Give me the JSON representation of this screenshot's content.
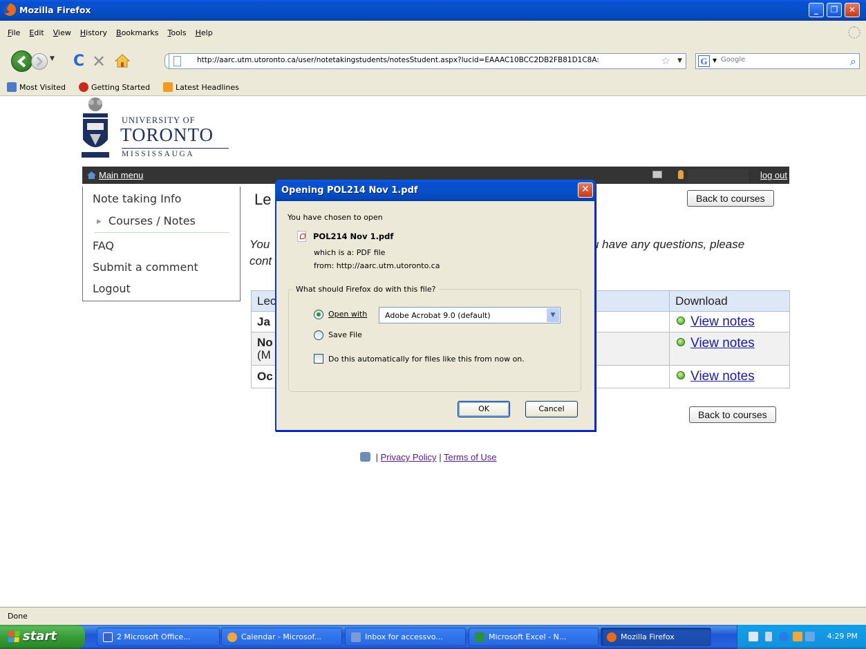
{
  "window": {
    "title": "Mozilla Firefox"
  },
  "menu": [
    "File",
    "Edit",
    "View",
    "History",
    "Bookmarks",
    "Tools",
    "Help"
  ],
  "nav": {
    "url": "http://aarc.utm.utoronto.ca/user/notetakingstudents/notesStudent.aspx?lucid=EAAAC10BCC2DB2FB81D1C8A:",
    "search_placeholder": "Google"
  },
  "bookmarks": [
    "Most Visited",
    "Getting Started",
    "Latest Headlines"
  ],
  "logo": {
    "line1": "UNIVERSITY OF",
    "line2": "TORONTO",
    "line3": "MISSISSAUGA"
  },
  "site_nav": {
    "main_menu": "Main menu",
    "logout": "log out"
  },
  "side_menu": {
    "items": [
      "Note taking Info",
      "Courses / Notes",
      "FAQ",
      "Submit a comment",
      "Logout"
    ]
  },
  "page": {
    "heading": "Le",
    "back_button": "Back to courses",
    "intro_line1_left": "You",
    "intro_line1_right": "u have any questions, please",
    "intro_line2": "cont"
  },
  "table": {
    "headers": [
      "Lec",
      "Download"
    ],
    "rows": [
      {
        "lecture": "Ja",
        "download": "View notes"
      },
      {
        "lecture": "No",
        "lecture2": "(M",
        "download": "View notes"
      },
      {
        "lecture": "Oc",
        "download": "View notes"
      }
    ]
  },
  "footer": {
    "separator": "|",
    "privacy": "Privacy Policy",
    "terms": "Terms of Use"
  },
  "dialog": {
    "title": "Opening POL214 Nov 1.pdf",
    "chosen_text": "You have chosen to open",
    "filename": "POL214 Nov 1.pdf",
    "which_is": "which is a:  PDF file",
    "from": "from:  http://aarc.utm.utoronto.ca",
    "question": "What should Firefox do with this file?",
    "open_with_label": "Open with",
    "open_with_value": "Adobe Acrobat 9.0 (default)",
    "save_file_label": "Save File",
    "auto_label": "Do this automatically for files like this from now on.",
    "ok": "OK",
    "cancel": "Cancel",
    "selected_option": "Open with",
    "auto_checked": false
  },
  "status": {
    "text": "Done"
  },
  "taskbar": {
    "start": "start",
    "tasks": [
      "2 Microsoft Office...",
      "Calendar - Microsof...",
      "Inbox for accessvo...",
      "Microsoft Excel - N...",
      "Mozilla Firefox"
    ],
    "clock": "4:29 PM"
  },
  "colors": {
    "xp_blue": "#0a4fd0",
    "link": "#1a1aa6",
    "visited": "#551a8b",
    "table_header": "#dde7f5"
  }
}
